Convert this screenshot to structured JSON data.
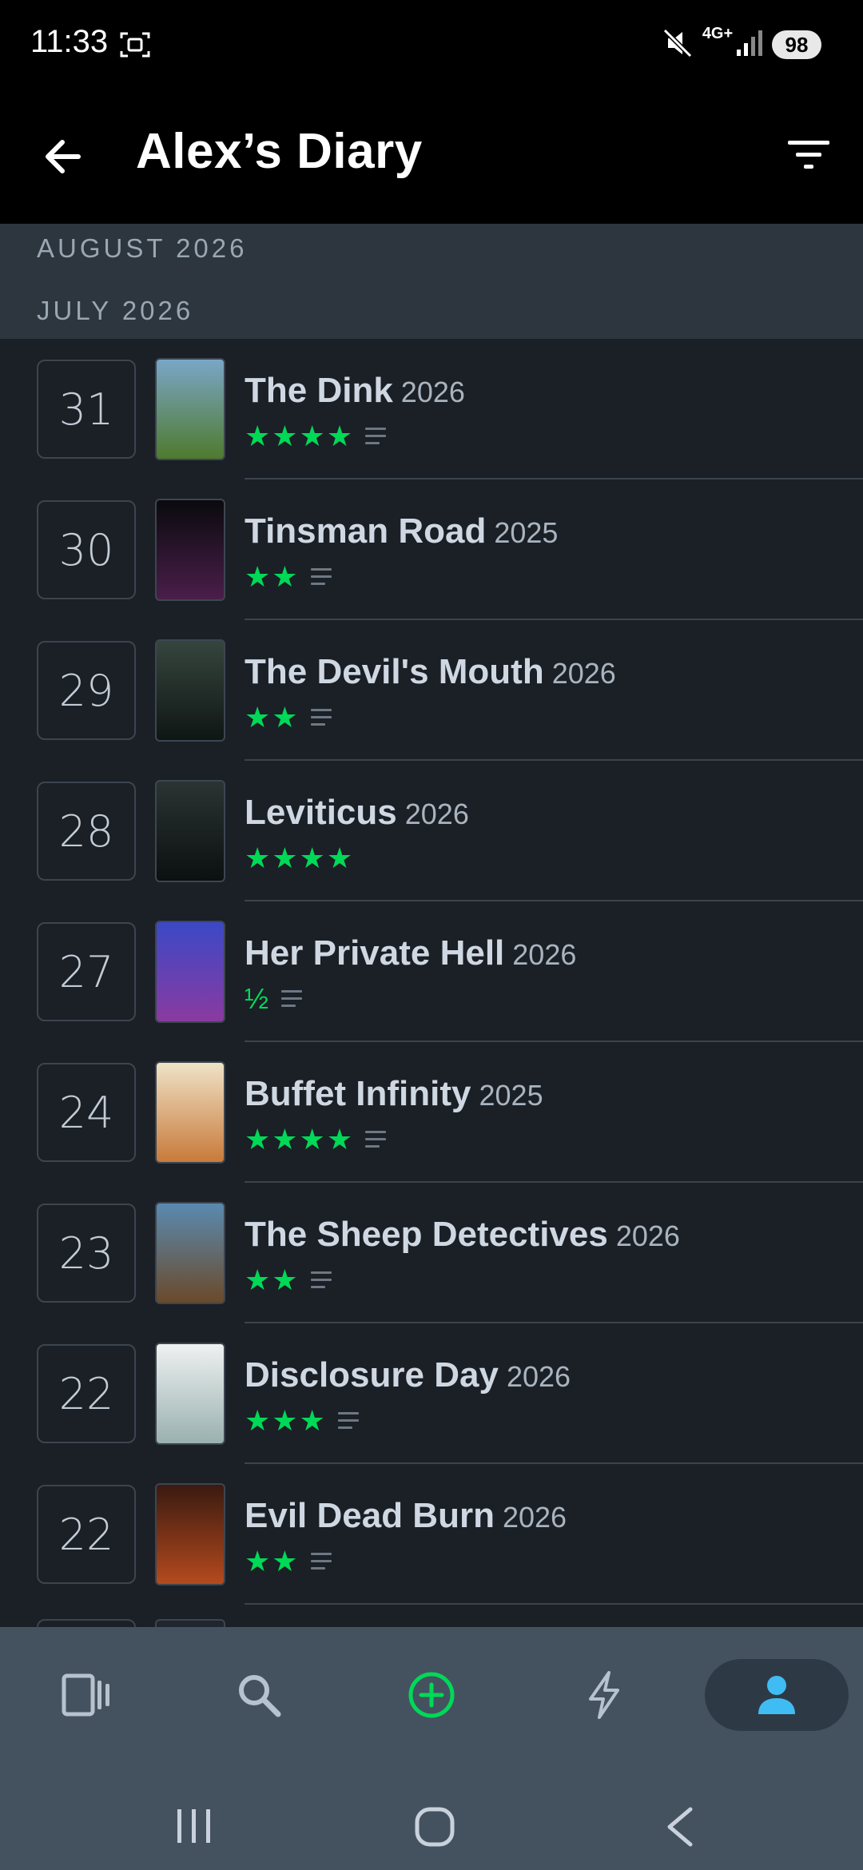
{
  "status_bar": {
    "time": "11:33",
    "network": "4G+",
    "battery": "98"
  },
  "header": {
    "title": "Alex’s Diary"
  },
  "months": [
    "AUGUST 2026",
    "JULY 2026"
  ],
  "entries": [
    {
      "day": "31",
      "title": "The Dink",
      "year": "2026",
      "stars": "★★★★",
      "review": true,
      "poster_colors": [
        "#7aa6c8",
        "#4f7a2e"
      ]
    },
    {
      "day": "30",
      "title": "Tinsman Road",
      "year": "2025",
      "stars": "★★",
      "review": true,
      "poster_colors": [
        "#0a0a0e",
        "#4a1e4a"
      ]
    },
    {
      "day": "29",
      "title": "The Devil's Mouth",
      "year": "2026",
      "stars": "★★",
      "review": true,
      "poster_colors": [
        "#36453e",
        "#0f1614"
      ]
    },
    {
      "day": "28",
      "title": "Leviticus",
      "year": "2026",
      "stars": "★★★★",
      "review": false,
      "poster_colors": [
        "#2a3432",
        "#0b1010"
      ]
    },
    {
      "day": "27",
      "title": "Her Private Hell",
      "year": "2026",
      "stars": "½",
      "review": true,
      "poster_colors": [
        "#3b49c6",
        "#8a3aa0"
      ]
    },
    {
      "day": "24",
      "title": "Buffet Infinity",
      "year": "2025",
      "stars": "★★★★",
      "review": true,
      "poster_colors": [
        "#efe2c7",
        "#c87a3a"
      ]
    },
    {
      "day": "23",
      "title": "The Sheep Detectives",
      "year": "2026",
      "stars": "★★",
      "review": true,
      "poster_colors": [
        "#5a8ab0",
        "#6a4a2a"
      ]
    },
    {
      "day": "22",
      "title": "Disclosure Day",
      "year": "2026",
      "stars": "★★★",
      "review": true,
      "poster_colors": [
        "#eef1f0",
        "#9ab0b0"
      ]
    },
    {
      "day": "22",
      "title": "Evil Dead Burn",
      "year": "2026",
      "stars": "★★",
      "review": true,
      "poster_colors": [
        "#3a1a10",
        "#b44a1e"
      ]
    }
  ],
  "colors": {
    "accent_green": "#00d957",
    "active_blue": "#40bcf4"
  },
  "bottom_nav": [
    "films-icon",
    "search-icon",
    "add-icon",
    "activity-icon",
    "profile-icon"
  ]
}
